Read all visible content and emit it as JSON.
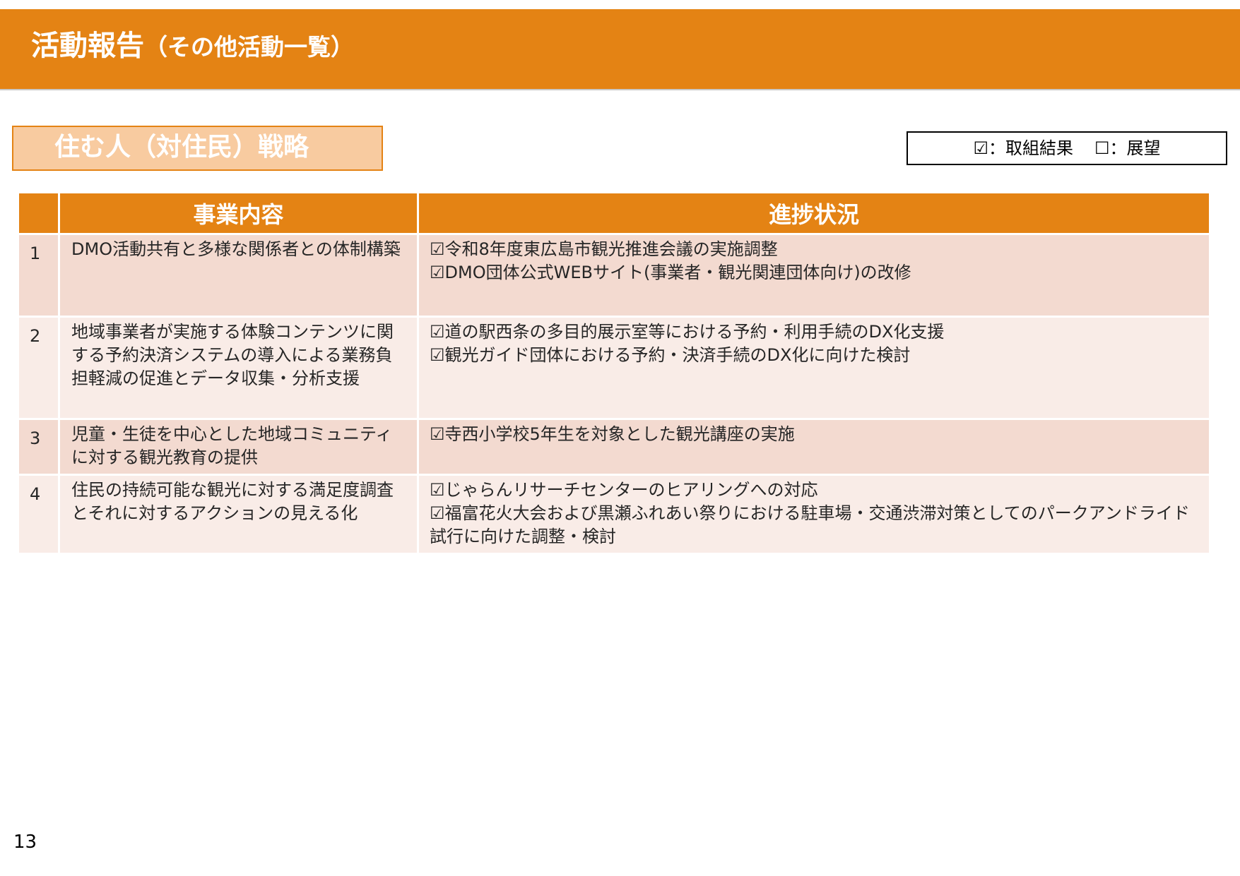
{
  "header": {
    "title": "活動報告",
    "subtitle": "（その他活動一覧）"
  },
  "section": {
    "label": "住む人（対住民）戦略"
  },
  "legend": {
    "done": "☑：取組結果",
    "plan": "☐：展望"
  },
  "table": {
    "columns": [
      "",
      "事業内容",
      "進捗状況"
    ],
    "rows": [
      {
        "num": "1",
        "content": "DMO活動共有と多様な関係者との体制構築",
        "status": [
          "☑令和8年度東広島市観光推進会議の実施調整",
          "☑DMO団体公式WEBサイト(事業者・観光関連団体向け)の改修"
        ]
      },
      {
        "num": "2",
        "content": "地域事業者が実施する体験コンテンツに関する予約決済システムの導入による業務負担軽減の促進とデータ収集・分析支援",
        "status": [
          "☑道の駅西条の多目的展示室等における予約・利用手続のDX化支援",
          "☑観光ガイド団体における予約・決済手続のDX化に向けた検討"
        ]
      },
      {
        "num": "3",
        "content": "児童・生徒を中心とした地域コミュニティに対する観光教育の提供",
        "status": [
          "☑寺西小学校5年生を対象とした観光講座の実施"
        ]
      },
      {
        "num": "4",
        "content": "住民の持続可能な観光に対する満足度調査とそれに対するアクションの見える化",
        "status": [
          "☑じゃらんリサーチセンターのヒアリングへの対応",
          "☑福富花火大会および黒瀬ふれあい祭りにおける駐車場・交通渋滞対策としてのパークアンドライド試行に向けた調整・検討"
        ]
      }
    ]
  },
  "page_number": "13",
  "colors": {
    "accent": "#e48314",
    "section_fill": "#f8cba0",
    "row_odd": "#f3dad0",
    "row_even": "#f9ece7"
  }
}
